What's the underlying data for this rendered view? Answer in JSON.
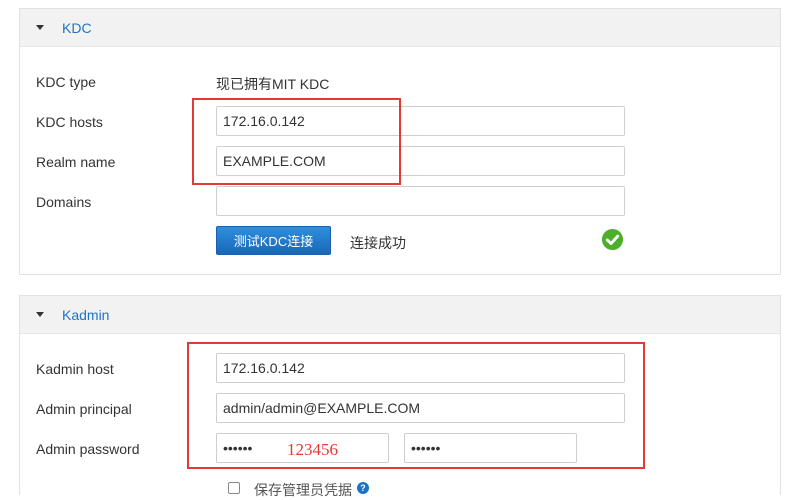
{
  "kdc_section": {
    "title": "KDC",
    "kdc_type_label": "KDC type",
    "kdc_type_value": "现已拥有MIT KDC",
    "kdc_hosts_label": "KDC hosts",
    "kdc_hosts_value": "172.16.0.142",
    "realm_name_label": "Realm name",
    "realm_name_value": "EXAMPLE.COM",
    "domains_label": "Domains",
    "domains_value": "",
    "test_button_label": "测试KDC连接",
    "connection_status": "连接成功"
  },
  "kadmin_section": {
    "title": "Kadmin",
    "kadmin_host_label": "Kadmin host",
    "kadmin_host_value": "172.16.0.142",
    "admin_principal_label": "Admin principal",
    "admin_principal_value": "admin/admin@EXAMPLE.COM",
    "admin_password_label": "Admin password",
    "admin_password_value": "••••••",
    "admin_password_confirm_value": "••••••",
    "save_credentials_label": "保存管理员凭据"
  },
  "annotation": {
    "password_hint": "123456"
  },
  "colors": {
    "link_blue": "#1f73c9",
    "primary_button": "#1a68b8",
    "success_green": "#4caf2a",
    "annotation_red": "#e53935"
  },
  "icons": {
    "collapse": "caret-down-icon",
    "success": "check-circle-icon",
    "help": "question-circle-icon"
  }
}
